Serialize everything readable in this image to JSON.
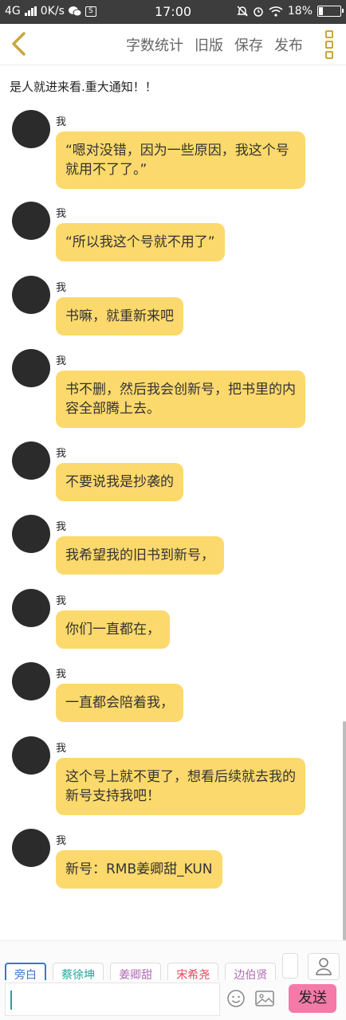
{
  "status_bar": {
    "network": "4G",
    "speed": "0K/s",
    "box_icon_label": "S",
    "time": "17:00",
    "battery": "18%",
    "battery_level": 0.18
  },
  "toolbar": {
    "word_count": "字数统计",
    "old_version": "旧版",
    "save": "保存",
    "publish": "发布"
  },
  "chat_title": "是人就进来看.重大通知！！",
  "messages": [
    {
      "sender": "我",
      "text": "“嗯对没错，因为一些原因，我这个号就用不了了。”"
    },
    {
      "sender": "我",
      "text": "“所以我这个号就不用了”"
    },
    {
      "sender": "我",
      "text": "书嘛，就重新来吧"
    },
    {
      "sender": "我",
      "text": "书不删，然后我会创新号，把书里的内容全部腾上去。"
    },
    {
      "sender": "我",
      "text": "不要说我是抄袭的"
    },
    {
      "sender": "我",
      "text": "我希望我的旧书到新号，"
    },
    {
      "sender": "我",
      "text": "你们一直都在，"
    },
    {
      "sender": "我",
      "text": "一直都会陪着我，"
    },
    {
      "sender": "我",
      "text": "这个号上就不更了，想看后续就去我的新号支持我吧！"
    },
    {
      "sender": "我",
      "text": "新号：RMB姜卿甜_KUN"
    }
  ],
  "characters": [
    {
      "name": "旁白",
      "color": "#3a78c8"
    },
    {
      "name": "蔡徐坤",
      "color": "#1fa79b"
    },
    {
      "name": "姜卿甜",
      "color": "#b06ab3"
    },
    {
      "name": "宋希尧",
      "color": "#e0455a"
    },
    {
      "name": "边伯贤",
      "color": "#b06ab3"
    }
  ],
  "input": {
    "value": "",
    "placeholder": ""
  },
  "send_label": "发送"
}
